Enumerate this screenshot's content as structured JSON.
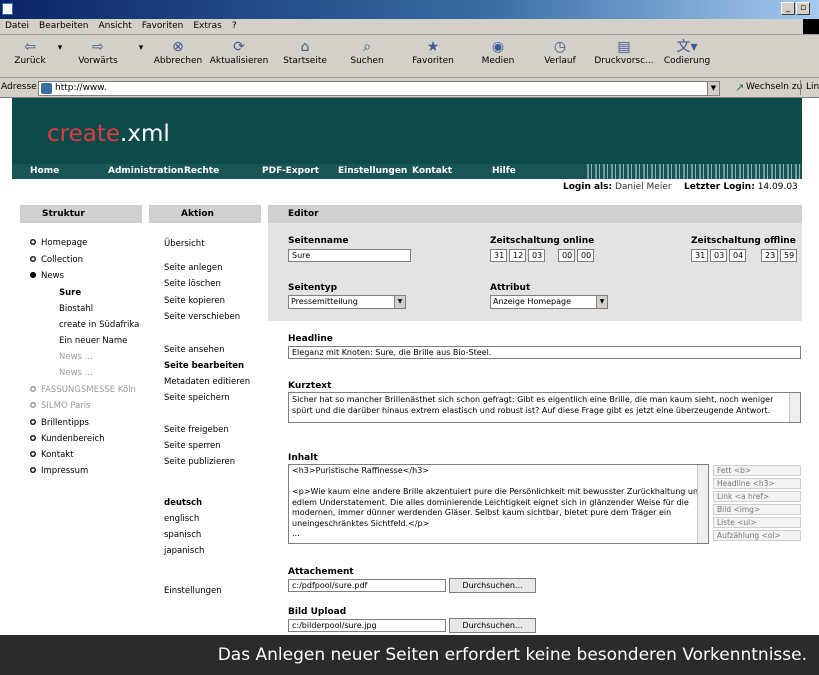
{
  "browser": {
    "menu": [
      "Datei",
      "Bearbeiten",
      "Ansicht",
      "Favoriten",
      "Extras",
      "?"
    ],
    "toolbar": [
      {
        "label": "Zurück",
        "icon": "back-arrow-icon"
      },
      {
        "label": "Vorwärts",
        "icon": "forward-arrow-icon"
      },
      {
        "label": "Abbrechen",
        "icon": "stop-icon"
      },
      {
        "label": "Aktualisieren",
        "icon": "refresh-icon"
      },
      {
        "label": "Startseite",
        "icon": "home-icon"
      },
      {
        "label": "Suchen",
        "icon": "search-icon"
      },
      {
        "label": "Favoriten",
        "icon": "favorites-icon"
      },
      {
        "label": "Medien",
        "icon": "media-icon"
      },
      {
        "label": "Verlauf",
        "icon": "history-icon"
      },
      {
        "label": "Druckvorsc...",
        "icon": "print-preview-icon"
      },
      {
        "label": "Codierung",
        "icon": "encoding-icon"
      }
    ],
    "address_label": "Adresse",
    "address_value": "http://www.",
    "go_label": "Wechseln zu",
    "links_label": "Lin"
  },
  "app": {
    "logo_part1": "create",
    "logo_part2": ".xml",
    "nav": [
      "Home",
      "Administration",
      "Rechte",
      "PDF-Export",
      "Einstellungen",
      "Kontakt",
      "Hilfe"
    ],
    "login_label": "Login als:",
    "login_user": "Daniel Meier",
    "last_login_label": "Letzter Login:",
    "last_login_value": "14.09.03",
    "col_struktur": "Struktur",
    "col_aktion": "Aktion",
    "col_editor": "Editor"
  },
  "tree": [
    {
      "label": "Homepage",
      "bullet": true,
      "style": "normal"
    },
    {
      "label": "Collection",
      "bullet": true,
      "style": "normal"
    },
    {
      "label": "News",
      "bullet": true,
      "style": "open"
    },
    {
      "label": "Sure",
      "bullet": false,
      "style": "selected"
    },
    {
      "label": "Biostahl",
      "bullet": false,
      "style": "child"
    },
    {
      "label": "create in Südafrika",
      "bullet": false,
      "style": "child"
    },
    {
      "label": "Ein neuer Name",
      "bullet": false,
      "style": "child"
    },
    {
      "label": "News ...",
      "bullet": false,
      "style": "childgray"
    },
    {
      "label": "News ...",
      "bullet": false,
      "style": "childgray"
    },
    {
      "label": "FASSUNGSMESSE Köln",
      "bullet": true,
      "style": "gray"
    },
    {
      "label": "SILMO Paris",
      "bullet": true,
      "style": "gray"
    },
    {
      "label": "Brillentipps",
      "bullet": true,
      "style": "normal"
    },
    {
      "label": "Kundenbereich",
      "bullet": true,
      "style": "normal"
    },
    {
      "label": "Kontakt",
      "bullet": true,
      "style": "normal"
    },
    {
      "label": "Impressum",
      "bullet": true,
      "style": "normal"
    }
  ],
  "actions": {
    "uebersicht": "Übersicht",
    "anlegen": "Seite anlegen",
    "loeschen": "Seite löschen",
    "kopieren": "Seite kopieren",
    "verschieben": "Seite verschieben",
    "ansehen": "Seite ansehen",
    "bearbeiten": "Seite bearbeiten",
    "metadaten": "Metadaten editieren",
    "speichern": "Seite speichern",
    "freigeben": "Seite freigeben",
    "sperren": "Seite sperren",
    "publizieren": "Seite publizieren",
    "deutsch": "deutsch",
    "englisch": "englisch",
    "spanisch": "spanisch",
    "japanisch": "japanisch",
    "einstellungen": "Einstellungen"
  },
  "editor": {
    "seitenname_label": "Seitenname",
    "seitenname_value": "Sure",
    "online_label": "Zeitschaltung online",
    "online_values": [
      "31",
      "12",
      "03",
      "00",
      "00"
    ],
    "offline_label": "Zeitschaltung offline",
    "offline_values": [
      "31",
      "03",
      "04",
      "23",
      "59"
    ],
    "seitentyp_label": "Seitentyp",
    "seitentyp_value": "Pressemitteilung",
    "attribut_label": "Attribut",
    "attribut_value": "Anzeige Homepage",
    "headline_label": "Headline",
    "headline_value": "Eleganz mit Knoten: Sure, die Brille aus Bio-Steel.",
    "kurztext_label": "Kurztext",
    "kurztext_line1": "Sicher hat so mancher Brillenästhet sich schon gefragt: Gibt es eigentlich eine Brille, die man kaum sieht, noch weniger",
    "kurztext_line2": "spürt und die darüber hinaus extrem elastisch und robust ist? Auf diese Frage gibt es jetzt eine überzeugende Antwort.",
    "inhalt_label": "Inhalt",
    "inhalt_lines": [
      "<h3>Puristische Raffinesse</h3>",
      "",
      "<p>Wie kaum eine andere Brille akzentuiert pure die Persönlichkeit mit bewusster Zurückhaltung und",
      "edlem Understatement. Die alles dominierende Leichtigkeit eignet sich in glänzender Weise für die",
      "modernen, immer dünner werdenden Gläser. Selbst kaum sichtbar, bietet pure dem Träger ein",
      "uneingeschränktes Sichtfeld.</p>",
      "..."
    ],
    "format_buttons": [
      "Fett <b>",
      "Headline <h3>",
      "Link <a href>",
      "Bild <img>",
      "Liste <ul>",
      "Aufzählung <ol>"
    ],
    "attachement_label": "Attachement",
    "attachement_value": "c:/pdfpool/sure.pdf",
    "browse_label": "Durchsuchen...",
    "bild_label": "Bild Upload",
    "bild_value": "c:/bilderpool/sure.jpg"
  },
  "caption": "Das Anlegen neuer Seiten erfordert keine besonderen Vorkenntnisse.",
  "colors": {
    "banner": "#0d4a4a",
    "navbar": "#1a5656",
    "logo_accent": "#e0393e",
    "header_grey": "#cfd0d0",
    "editor_grey": "#e3e3e3"
  }
}
